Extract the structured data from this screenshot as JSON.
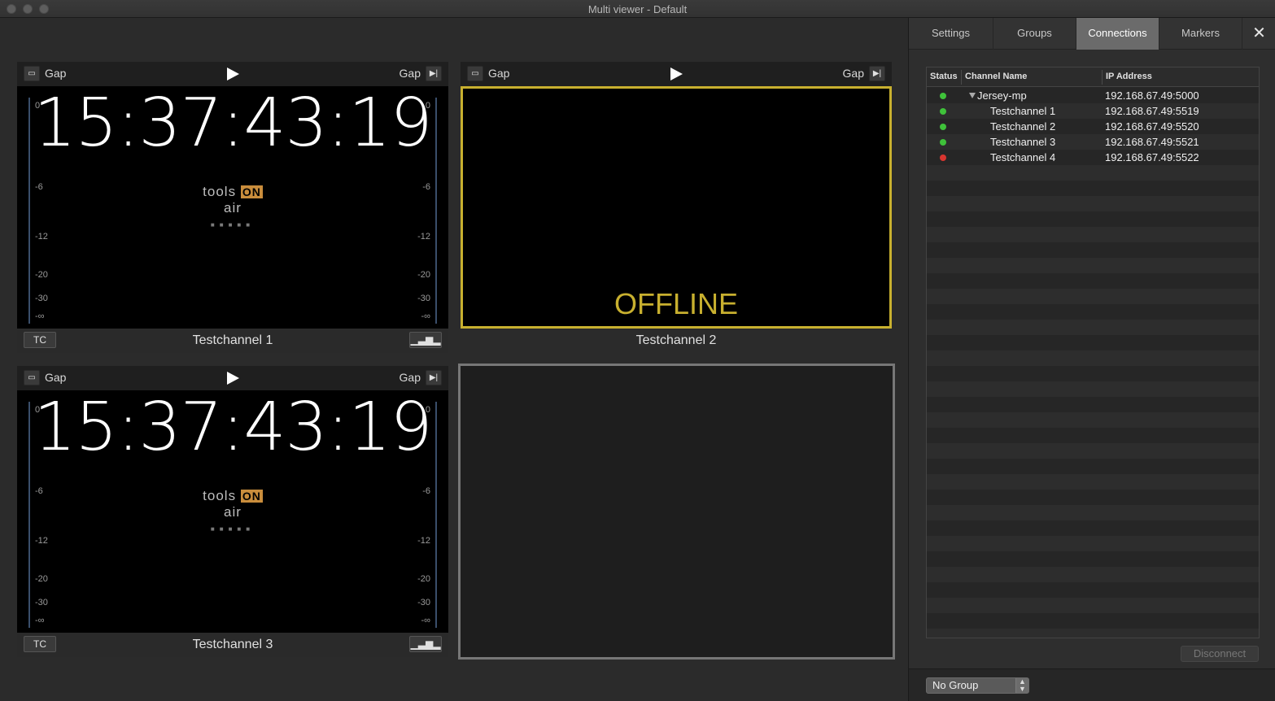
{
  "window": {
    "title": "Multi viewer - Default"
  },
  "tiles": [
    {
      "left_label": "Gap",
      "right_label": "Gap",
      "timecode": "15:37:43:19",
      "channel": "Testchannel 1",
      "tc_label": "TC"
    },
    {
      "left_label": "Gap",
      "right_label": "Gap",
      "status": "OFFLINE",
      "channel": "Testchannel 2"
    },
    {
      "left_label": "Gap",
      "right_label": "Gap",
      "timecode": "15:37:43:19",
      "channel": "Testchannel 3",
      "tc_label": "TC"
    }
  ],
  "logo": {
    "pre": "tools",
    "on": "ON",
    "post": "air"
  },
  "meter_labels": [
    "0",
    "-6",
    "-12",
    "-20",
    "-30",
    "-∞"
  ],
  "panel": {
    "tabs": [
      "Settings",
      "Groups",
      "Connections",
      "Markers"
    ],
    "active_tab": "Connections",
    "table": {
      "headers": [
        "Status",
        "Channel Name",
        "IP Address"
      ],
      "rows": [
        {
          "status": "green",
          "name": "Jersey-mp",
          "ip": "192.168.67.49:5000",
          "expanded": true
        },
        {
          "status": "green",
          "name": "Testchannel 1",
          "ip": "192.168.67.49:5519"
        },
        {
          "status": "green",
          "name": "Testchannel 2",
          "ip": "192.168.67.49:5520"
        },
        {
          "status": "green",
          "name": "Testchannel 3",
          "ip": "192.168.67.49:5521"
        },
        {
          "status": "red",
          "name": "Testchannel 4",
          "ip": "192.168.67.49:5522"
        }
      ]
    },
    "disconnect_label": "Disconnect",
    "group_select": "No Group"
  },
  "colors": {
    "status_green": "#3fc23a",
    "status_red": "#d8352f",
    "offline_yellow": "#c8b02f",
    "active_tab": "#6b6b6b"
  }
}
